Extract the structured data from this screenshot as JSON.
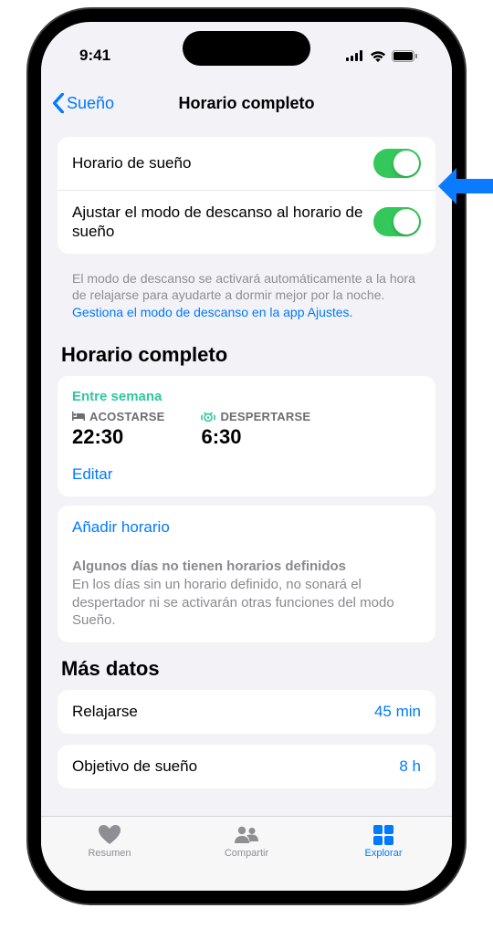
{
  "status": {
    "time": "9:41"
  },
  "nav": {
    "back": "Sueño",
    "title": "Horario completo"
  },
  "toggles": {
    "schedule": {
      "label": "Horario de sueño",
      "on": true
    },
    "winddown": {
      "label": "Ajustar el modo de descanso al horario de sueño",
      "on": true
    }
  },
  "footnote": {
    "text": "El modo de descanso se activará automáticamente a la hora de relajarse para ayudarte a dormir mejor por la noche. ",
    "link": "Gestiona el modo de descanso en la app Ajustes."
  },
  "full_schedule": {
    "header": "Horario completo",
    "period": "Entre semana",
    "bed": {
      "label": "ACOSTARSE",
      "time": "22:30"
    },
    "wake": {
      "label": "DESPERTARSE",
      "time": "6:30"
    },
    "edit": "Editar"
  },
  "add": {
    "link": "Añadir horario",
    "note_title": "Algunos días no tienen horarios definidos",
    "note_body": "En los días sin un horario definido, no sonará el despertador ni se activarán otras funciones del modo Sueño."
  },
  "more": {
    "header": "Más datos",
    "winddown": {
      "label": "Relajarse",
      "value": "45 min"
    },
    "goal": {
      "label": "Objetivo de sueño",
      "value": "8 h"
    }
  },
  "tabs": {
    "summary": "Resumen",
    "share": "Compartir",
    "browse": "Explorar"
  }
}
